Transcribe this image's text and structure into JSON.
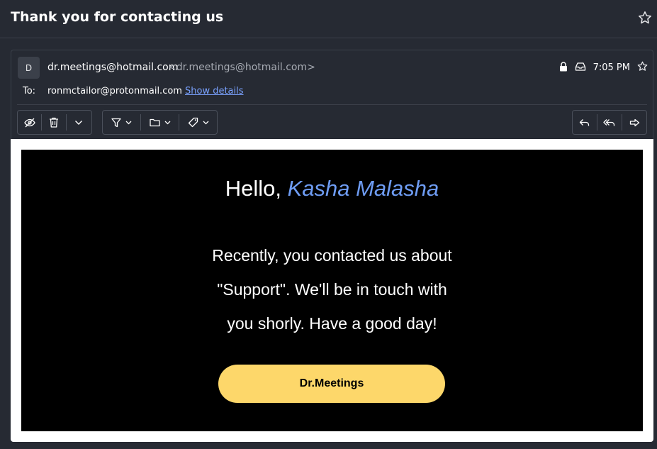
{
  "subject": "Thank you for contacting us",
  "sender": {
    "initial": "D",
    "name": "dr.meetings@hotmail.com",
    "address": "<dr.meetings@hotmail.com>"
  },
  "time": "7:05 PM",
  "recipient": {
    "label": "To:",
    "address": "ronmctailor@protonmail.com",
    "show_details": "Show details"
  },
  "toolbar": {
    "left_groups": [
      [
        "mark-unread-icon",
        "trash-icon",
        "more-dropdown-icon"
      ],
      [
        "filter-icon",
        "move-to-folder-icon",
        "label-icon"
      ]
    ],
    "right_group": [
      "reply-icon",
      "reply-all-icon",
      "forward-icon"
    ]
  },
  "body": {
    "greeting": "Hello, ",
    "name": "Kasha Malasha",
    "lines": [
      "Recently, you contacted us about",
      "\"Support\". We'll be in touch with",
      "you shorly. Have a good day!"
    ],
    "button": "Dr.Meetings"
  },
  "colors": {
    "background": "#262a33",
    "link": "#7aa2ff",
    "name_accent": "#6e9cf3",
    "button": "#fdd76a"
  }
}
